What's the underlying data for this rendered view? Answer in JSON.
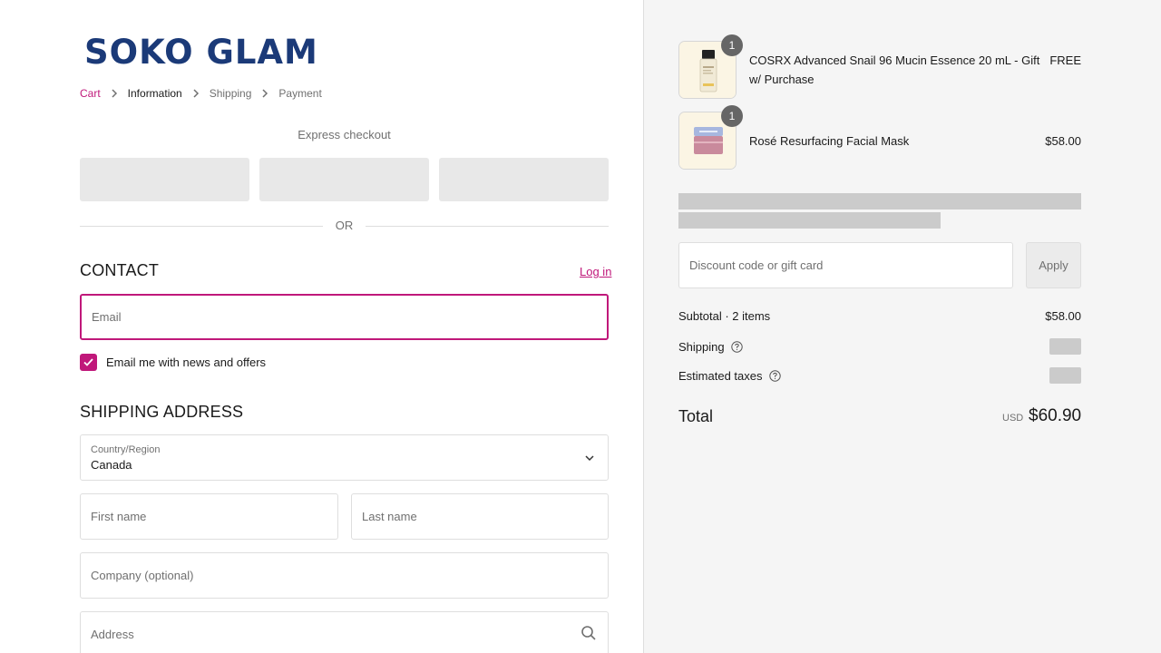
{
  "brand": {
    "logo_text": "SOKO GLAM",
    "accent_color": "#c0187a",
    "logo_color": "#1b3a78"
  },
  "breadcrumb": [
    {
      "label": "Cart"
    },
    {
      "label": "Information"
    },
    {
      "label": "Shipping"
    },
    {
      "label": "Payment"
    }
  ],
  "express_checkout": {
    "title": "Express checkout",
    "divider_text": "OR"
  },
  "contact": {
    "title": "CONTACT",
    "login_label": "Log in",
    "email_placeholder": "Email",
    "newsletter_label": "Email me with news and offers",
    "newsletter_checked": true
  },
  "shipping_address": {
    "title": "SHIPPING ADDRESS",
    "country_label": "Country/Region",
    "country_value": "Canada",
    "first_name_placeholder": "First name",
    "last_name_placeholder": "Last name",
    "company_placeholder": "Company (optional)",
    "address_placeholder": "Address"
  },
  "order_summary": {
    "items": [
      {
        "quantity": "1",
        "name": "COSRX Advanced Snail 96 Mucin Essence 20 mL - Gift w/ Purchase",
        "price": "FREE"
      },
      {
        "quantity": "1",
        "name": "Rosé Resurfacing Facial Mask",
        "price": "$58.00"
      }
    ],
    "discount_placeholder": "Discount code or gift card",
    "apply_label": "Apply",
    "subtotal_label": "Subtotal · 2 items",
    "subtotal_value": "$58.00",
    "shipping_label": "Shipping",
    "taxes_label": "Estimated taxes",
    "total_label": "Total",
    "total_currency": "USD",
    "total_value": "$60.90"
  }
}
